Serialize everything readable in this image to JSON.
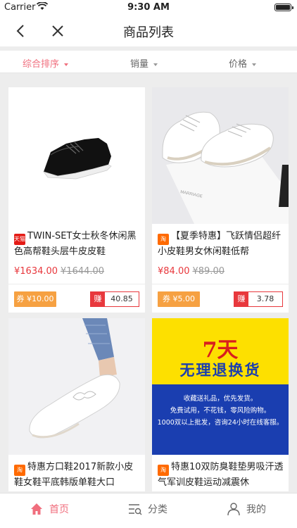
{
  "status_bar": {
    "carrier": "Carrier",
    "time": "9:30 AM"
  },
  "nav": {
    "title": "商品列表"
  },
  "filters": [
    {
      "label": "综合排序",
      "active": true
    },
    {
      "label": "销量",
      "active": false
    },
    {
      "label": "价格",
      "active": false
    }
  ],
  "products": [
    {
      "badge": "天猫",
      "title": "TWIN-SET女士秋冬休闲黑色高帮鞋头层牛皮皮鞋",
      "price": "¥1634.00",
      "original_price": "¥1644.00",
      "coupon": "券 ¥10.00",
      "earn_label": "赚",
      "earn_value": "40.85"
    },
    {
      "badge": "淘",
      "title": "【夏季特惠】飞跃情侣超纤小皮鞋男女休闲鞋低帮",
      "price": "¥84.00",
      "original_price": "¥89.00",
      "coupon": "券 ¥5.00",
      "earn_label": "赚",
      "earn_value": "3.78"
    },
    {
      "badge": "淘",
      "title": "特惠方口鞋2017新款小皮鞋女鞋平底韩版单鞋大口"
    },
    {
      "badge": "淘",
      "title": "特惠10双防臭鞋垫男吸汗透气军训皮鞋运动减震休"
    }
  ],
  "promo": {
    "big": "7天",
    "headline": "无理退换货",
    "lines": [
      "收藏送礼品，优先发货。",
      "免费试用，不花钱，零风险购物。",
      "1000双以上批发，咨询24小时在线客服。"
    ]
  },
  "tabs": [
    {
      "label": "首页",
      "icon": "home-icon",
      "active": true
    },
    {
      "label": "分类",
      "icon": "category-icon",
      "active": false
    },
    {
      "label": "我的",
      "icon": "user-icon",
      "active": false
    }
  ],
  "colors": {
    "accent": "#f06e7d",
    "price": "#e8383d",
    "coupon": "#f6a142",
    "tmall": "#e41c17",
    "taobao": "#ff6a00"
  }
}
